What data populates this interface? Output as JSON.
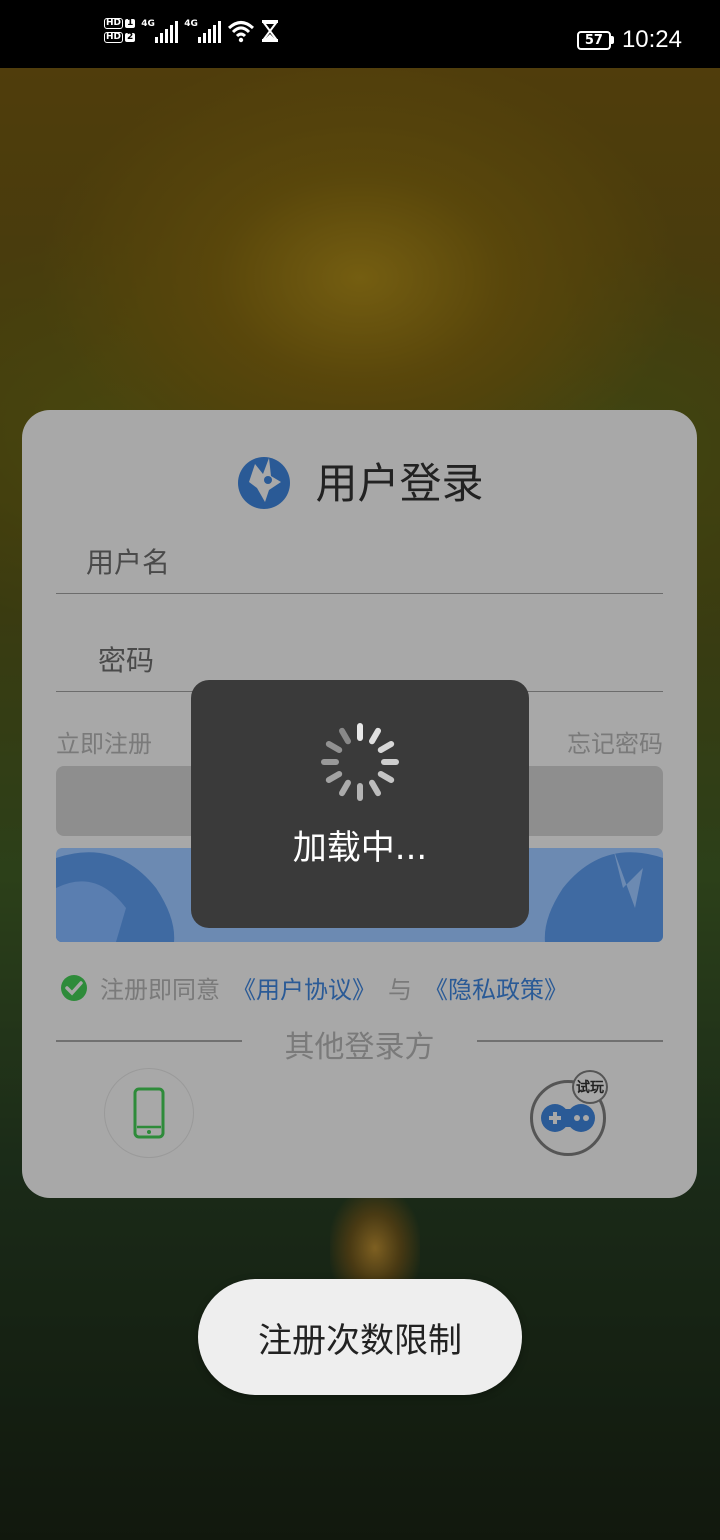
{
  "status_bar": {
    "sim1_tag": "HD",
    "sim1_num": "1",
    "sim2_tag": "HD",
    "sim2_num": "2",
    "net1": "4G",
    "net2": "4G",
    "battery": "57",
    "time": "10:24"
  },
  "login": {
    "title": "用户登录",
    "username_placeholder": "用户名",
    "password_placeholder": "密码",
    "register_link": "立即注册",
    "forgot_link": "忘记密码",
    "agreement_prefix": "注册即同意",
    "user_agreement": "《用户协议》",
    "agreement_and": "与",
    "privacy_policy": "《隐私政策》",
    "other_login": "其他登录方",
    "trial_badge": "试玩"
  },
  "loading": {
    "text": "加载中..."
  },
  "toast": {
    "text": "注册次数限制"
  },
  "colors": {
    "card_bg": "#a8a8a8",
    "brand_blue": "#2a5a96",
    "button_blue": "#6c8ab2",
    "check_green": "#2e8b3a",
    "loading_bg": "#3a3a3a"
  }
}
